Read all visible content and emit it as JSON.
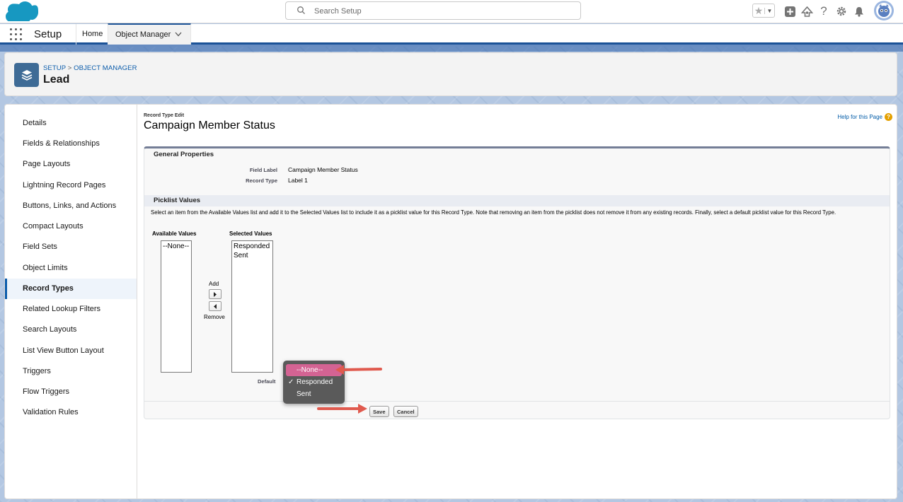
{
  "global_header": {
    "search_placeholder": "Search Setup"
  },
  "app_nav": {
    "app_name": "Setup",
    "tabs": [
      {
        "label": "Home"
      },
      {
        "label": "Object Manager"
      }
    ]
  },
  "page_header": {
    "breadcrumb_setup": "SETUP",
    "breadcrumb_sep": " > ",
    "breadcrumb_objmgr": "OBJECT MANAGER",
    "title": "Lead"
  },
  "sidebar": {
    "items": [
      {
        "label": "Details"
      },
      {
        "label": "Fields & Relationships"
      },
      {
        "label": "Page Layouts"
      },
      {
        "label": "Lightning Record Pages"
      },
      {
        "label": "Buttons, Links, and Actions"
      },
      {
        "label": "Compact Layouts"
      },
      {
        "label": "Field Sets"
      },
      {
        "label": "Object Limits"
      },
      {
        "label": "Record Types"
      },
      {
        "label": "Related Lookup Filters"
      },
      {
        "label": "Search Layouts"
      },
      {
        "label": "List View Button Layout"
      },
      {
        "label": "Triggers"
      },
      {
        "label": "Flow Triggers"
      },
      {
        "label": "Validation Rules"
      }
    ],
    "active_index": 8
  },
  "content": {
    "pre_title": "Record Type Edit",
    "title": "Campaign Member Status",
    "help_link": "Help for this Page",
    "general_properties": {
      "header": "General Properties",
      "field_label_lbl": "Field Label",
      "field_label_val": "Campaign Member Status",
      "record_type_lbl": "Record Type",
      "record_type_val": "Label 1"
    },
    "picklist": {
      "header": "Picklist Values",
      "description": "Select an item from the Available Values list and add it to the Selected Values list to include it as a picklist value for this Record Type. Note that removing an item from the picklist does not remove it from any existing records. Finally, select a default picklist value for this Record Type.",
      "available_label": "Available Values",
      "selected_label": "Selected Values",
      "available_values": [
        "--None--"
      ],
      "selected_values": [
        "Responded",
        "Sent"
      ],
      "add_label": "Add",
      "remove_label": "Remove",
      "default_label": "Default"
    },
    "buttons": {
      "save": "Save",
      "cancel": "Cancel"
    }
  },
  "default_dropdown": {
    "options": [
      "--None--",
      "Responded",
      "Sent"
    ],
    "highlighted_index": 0,
    "checked_index": 1,
    "check_glyph": "✓"
  },
  "colors": {
    "brand_blue": "#1b5297",
    "link_blue": "#0b5cab",
    "dropdown_highlight": "#d46393",
    "annotation_arrow": "#e05a4e"
  }
}
